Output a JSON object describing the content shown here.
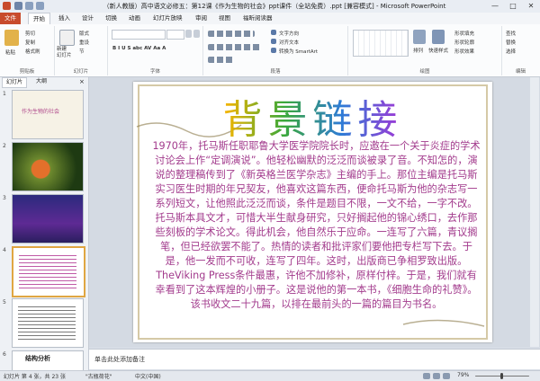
{
  "window": {
    "title": "（新人教版）高中语文必修五：第12课《作为生物的社会》ppt课件（全站免费）.ppt [兼容模式] - Microsoft PowerPoint",
    "minimize": "—",
    "maximize": "□",
    "close": "✕"
  },
  "menu": {
    "file": "文件",
    "tabs": [
      "开始",
      "插入",
      "设计",
      "切换",
      "动画",
      "幻灯片放映",
      "审阅",
      "视图",
      "福昕阅读器"
    ]
  },
  "ribbon": {
    "paste": "粘贴",
    "cut": "剪切",
    "copy": "复制",
    "format_painter": "格式刷",
    "clipboard": "剪贴板",
    "new_slide": "新建\n幻灯片",
    "layout": "版式",
    "reset": "重设",
    "section": "节",
    "slides": "幻灯片",
    "font_group": "字体",
    "font_buttons": "B  I  U  S  abc  AV  Aa  A",
    "paragraph_group": "段落",
    "text_direction": "文字方向",
    "align_text": "对齐文本",
    "smartart": "转换为 SmartArt",
    "drawing_group": "绘图",
    "arrange": "排列",
    "quick_styles": "快速样式",
    "shape_fill": "形状填充",
    "shape_outline": "形状轮廓",
    "shape_effects": "形状效果",
    "find": "查找",
    "replace": "替换",
    "select": "选择",
    "editing": "编辑"
  },
  "left_pane": {
    "tab_slides": "幻灯片",
    "tab_outline": "大纲",
    "thumb_numbers": [
      "1",
      "2",
      "3",
      "4",
      "5",
      "6"
    ],
    "thumb1_text": "作为生物的社会",
    "thumb6_text": "结构分析"
  },
  "slide": {
    "title": "背景链接",
    "body": "1970年，托马斯任职耶鲁大学医学院院长时，应邀在一个关于炎症的学术讨论会上作“定调演说”。他轻松幽默的泛泛而谈被录了音。不知怎的，演说的整理稿传到了《新英格兰医学杂志》主编的手上。那位主编是托马斯实习医生时期的年兄契友，他喜欢这篇东西，便命托马斯为他的杂志写一系列短文，让他照此泛泛而谈，条件是题目不限，一文不给，一字不改。托马斯本具文才，可惜大半生献身研究，只好搁起他的锦心绣口，去作那些刻板的学术论文。得此机会，他自然乐于应命。一连写了六篇，青议搁笔，但已经欲罢不能了。热情的读者和批评家们要他把专栏写下去。于是，他一发而不可收，连写了四年。这时，出版商已争相罗致出版。TheViking Press条件最惠，许他不加修补，原样付梓。于是，我们就有幸看到了这本辉煌的小册子。这是说他的第一本书，《细胞生命的礼赞》。该书收文二十九篇，以排在最前头的一篇的篇目为书名。"
  },
  "notes": {
    "placeholder": "单击此处添加备注"
  },
  "status": {
    "slide_info": "幻灯片 第 4 张，共 23 张",
    "theme": "\"古瓶荷花\"",
    "language": "中文(中国)",
    "zoom": "79%"
  }
}
